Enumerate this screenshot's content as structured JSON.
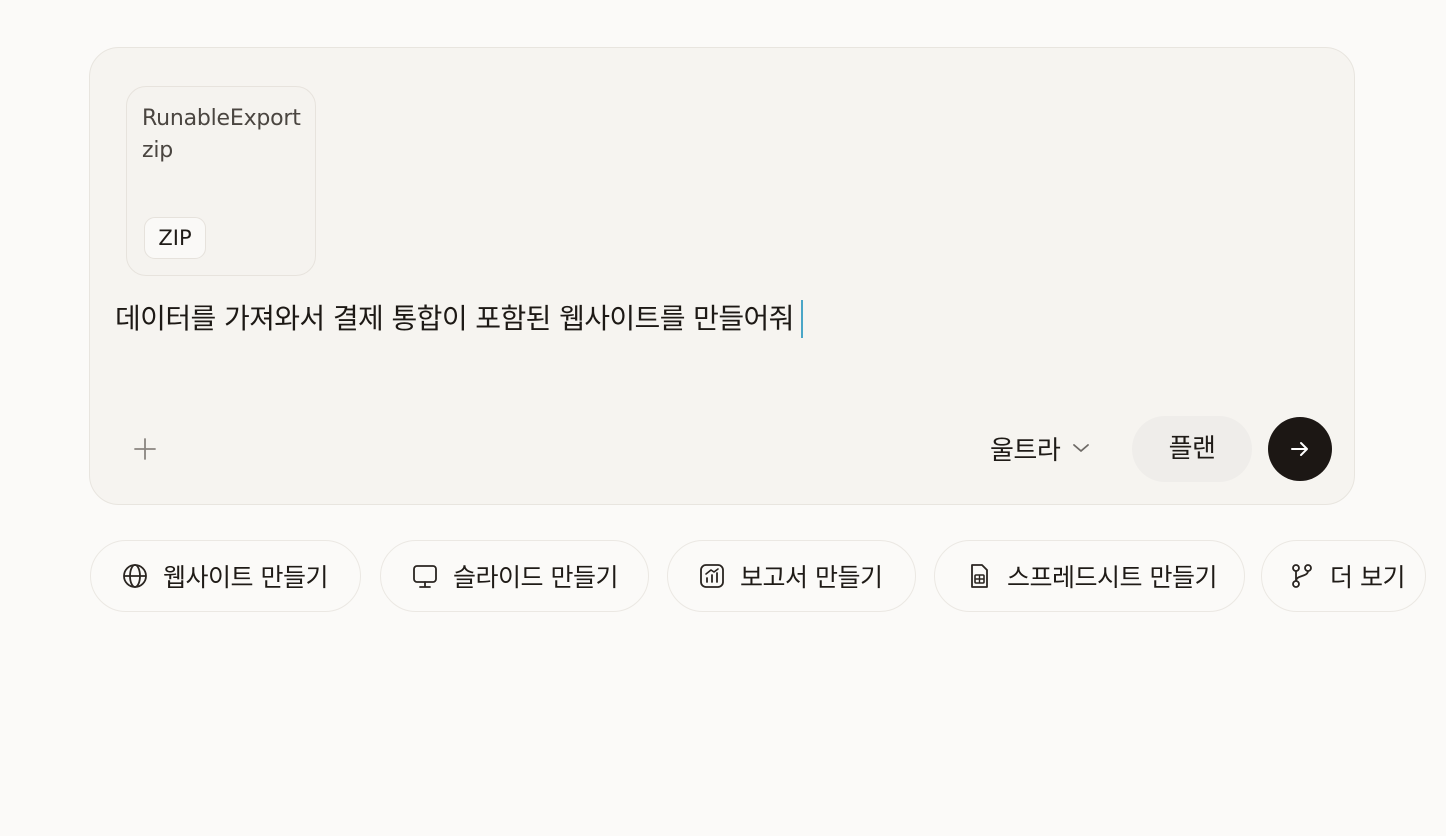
{
  "composer": {
    "attachment": {
      "name": "RunableExport zip",
      "type": "ZIP"
    },
    "prompt": "데이터를 가져와서 결제 통합이 포함된 웹사이트를 만들어줘",
    "add_icon": "plus-icon",
    "mode": {
      "label": "울트라",
      "icon": "chevron-down-icon"
    },
    "plan_label": "플랜",
    "send_icon": "arrow-right-icon",
    "send_color": "#1c1714",
    "cursor_color": "#4aa6c7"
  },
  "suggestions": [
    {
      "label": "웹사이트 만들기",
      "icon": "globe-icon"
    },
    {
      "label": "슬라이드 만들기",
      "icon": "presentation-icon"
    },
    {
      "label": "보고서 만들기",
      "icon": "chart-icon"
    },
    {
      "label": "스프레드시트 만들기",
      "icon": "spreadsheet-icon"
    },
    {
      "label": "더 보기",
      "icon": "branch-icon"
    }
  ]
}
